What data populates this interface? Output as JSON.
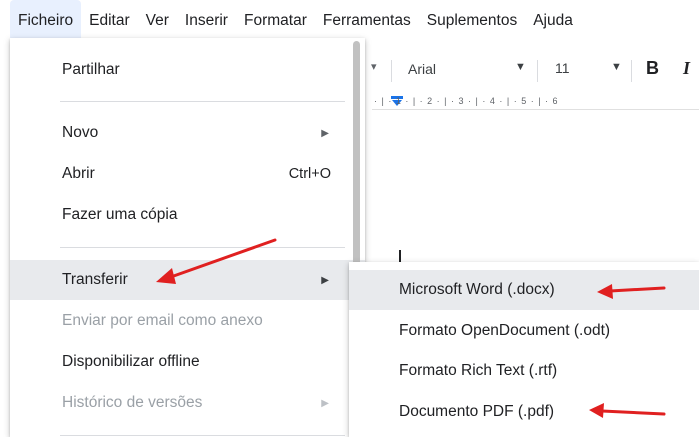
{
  "menubar": {
    "items": [
      "Ficheiro",
      "Editar",
      "Ver",
      "Inserir",
      "Formatar",
      "Ferramentas",
      "Suplementos",
      "Ajuda"
    ]
  },
  "toolbar": {
    "font": "Arial",
    "font_size": "11",
    "bold": "B",
    "italic": "I"
  },
  "ruler": {
    "text": "· | · 1 · | · 2 · | · 3 · | · 4 · | · 5 · | · 6"
  },
  "file_menu": {
    "items": [
      {
        "label": "Partilhar"
      },
      {
        "label": "Novo"
      },
      {
        "label": "Abrir",
        "shortcut": "Ctrl+O"
      },
      {
        "label": "Fazer uma cópia"
      },
      {
        "label": "Transferir"
      },
      {
        "label": "Enviar por email como anexo"
      },
      {
        "label": "Disponibilizar offline"
      },
      {
        "label": "Histórico de versões"
      }
    ]
  },
  "download_submenu": {
    "items": [
      {
        "label": "Microsoft Word (.docx)"
      },
      {
        "label": "Formato OpenDocument (.odt)"
      },
      {
        "label": "Formato Rich Text (.rtf)"
      },
      {
        "label": "Documento PDF (.pdf)"
      }
    ]
  },
  "colors": {
    "annotation_arrow": "#e02020",
    "menu_active_bg": "#e8f0fe",
    "highlight_bg": "#e8eaed",
    "ruler_marker": "#1a73e8"
  }
}
